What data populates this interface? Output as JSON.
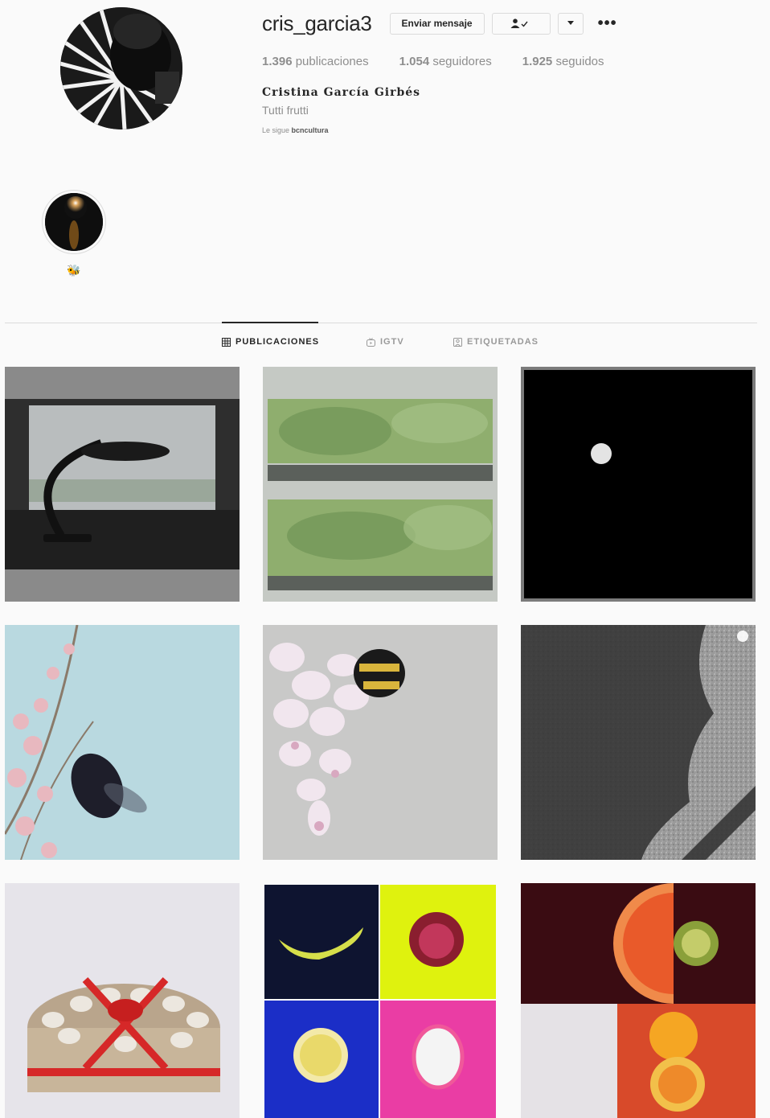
{
  "profile": {
    "username": "cris_garcia3",
    "message_button": "Enviar mensaje",
    "more_glyph": "•••",
    "stats": {
      "posts_count": "1.396",
      "posts_label": "publicaciones",
      "followers_count": "1.054",
      "followers_label": "seguidores",
      "following_count": "1.925",
      "following_label": "seguidos"
    },
    "full_name": "Cristina García Girbés",
    "bio": "Tutti frutti",
    "followed_by_prefix": "Le sigue",
    "followed_by_user": "bcncultura"
  },
  "highlight": {
    "label": "🐝"
  },
  "tabs": [
    {
      "label": "PUBLICACIONES",
      "icon": "grid-icon",
      "active": true
    },
    {
      "label": "IGTV",
      "icon": "igtv-icon",
      "active": false
    },
    {
      "label": "ETIQUETADAS",
      "icon": "tag-icon",
      "active": false
    }
  ],
  "colors": {
    "text": "#262626",
    "muted": "#8e8e8e",
    "border": "#dbdbdb",
    "bg": "#fafafa"
  },
  "posts": [
    {
      "subject": "desk-lamp-window"
    },
    {
      "subject": "green-through-blinds"
    },
    {
      "subject": "moon-black-sky"
    },
    {
      "subject": "bee-on-blossom"
    },
    {
      "subject": "bumblebee-on-wisteria"
    },
    {
      "subject": "shadow-on-asphalt"
    },
    {
      "subject": "cardboard-roll-cake"
    },
    {
      "subject": "fruit-quad-grid"
    },
    {
      "subject": "citrus-collage"
    }
  ]
}
